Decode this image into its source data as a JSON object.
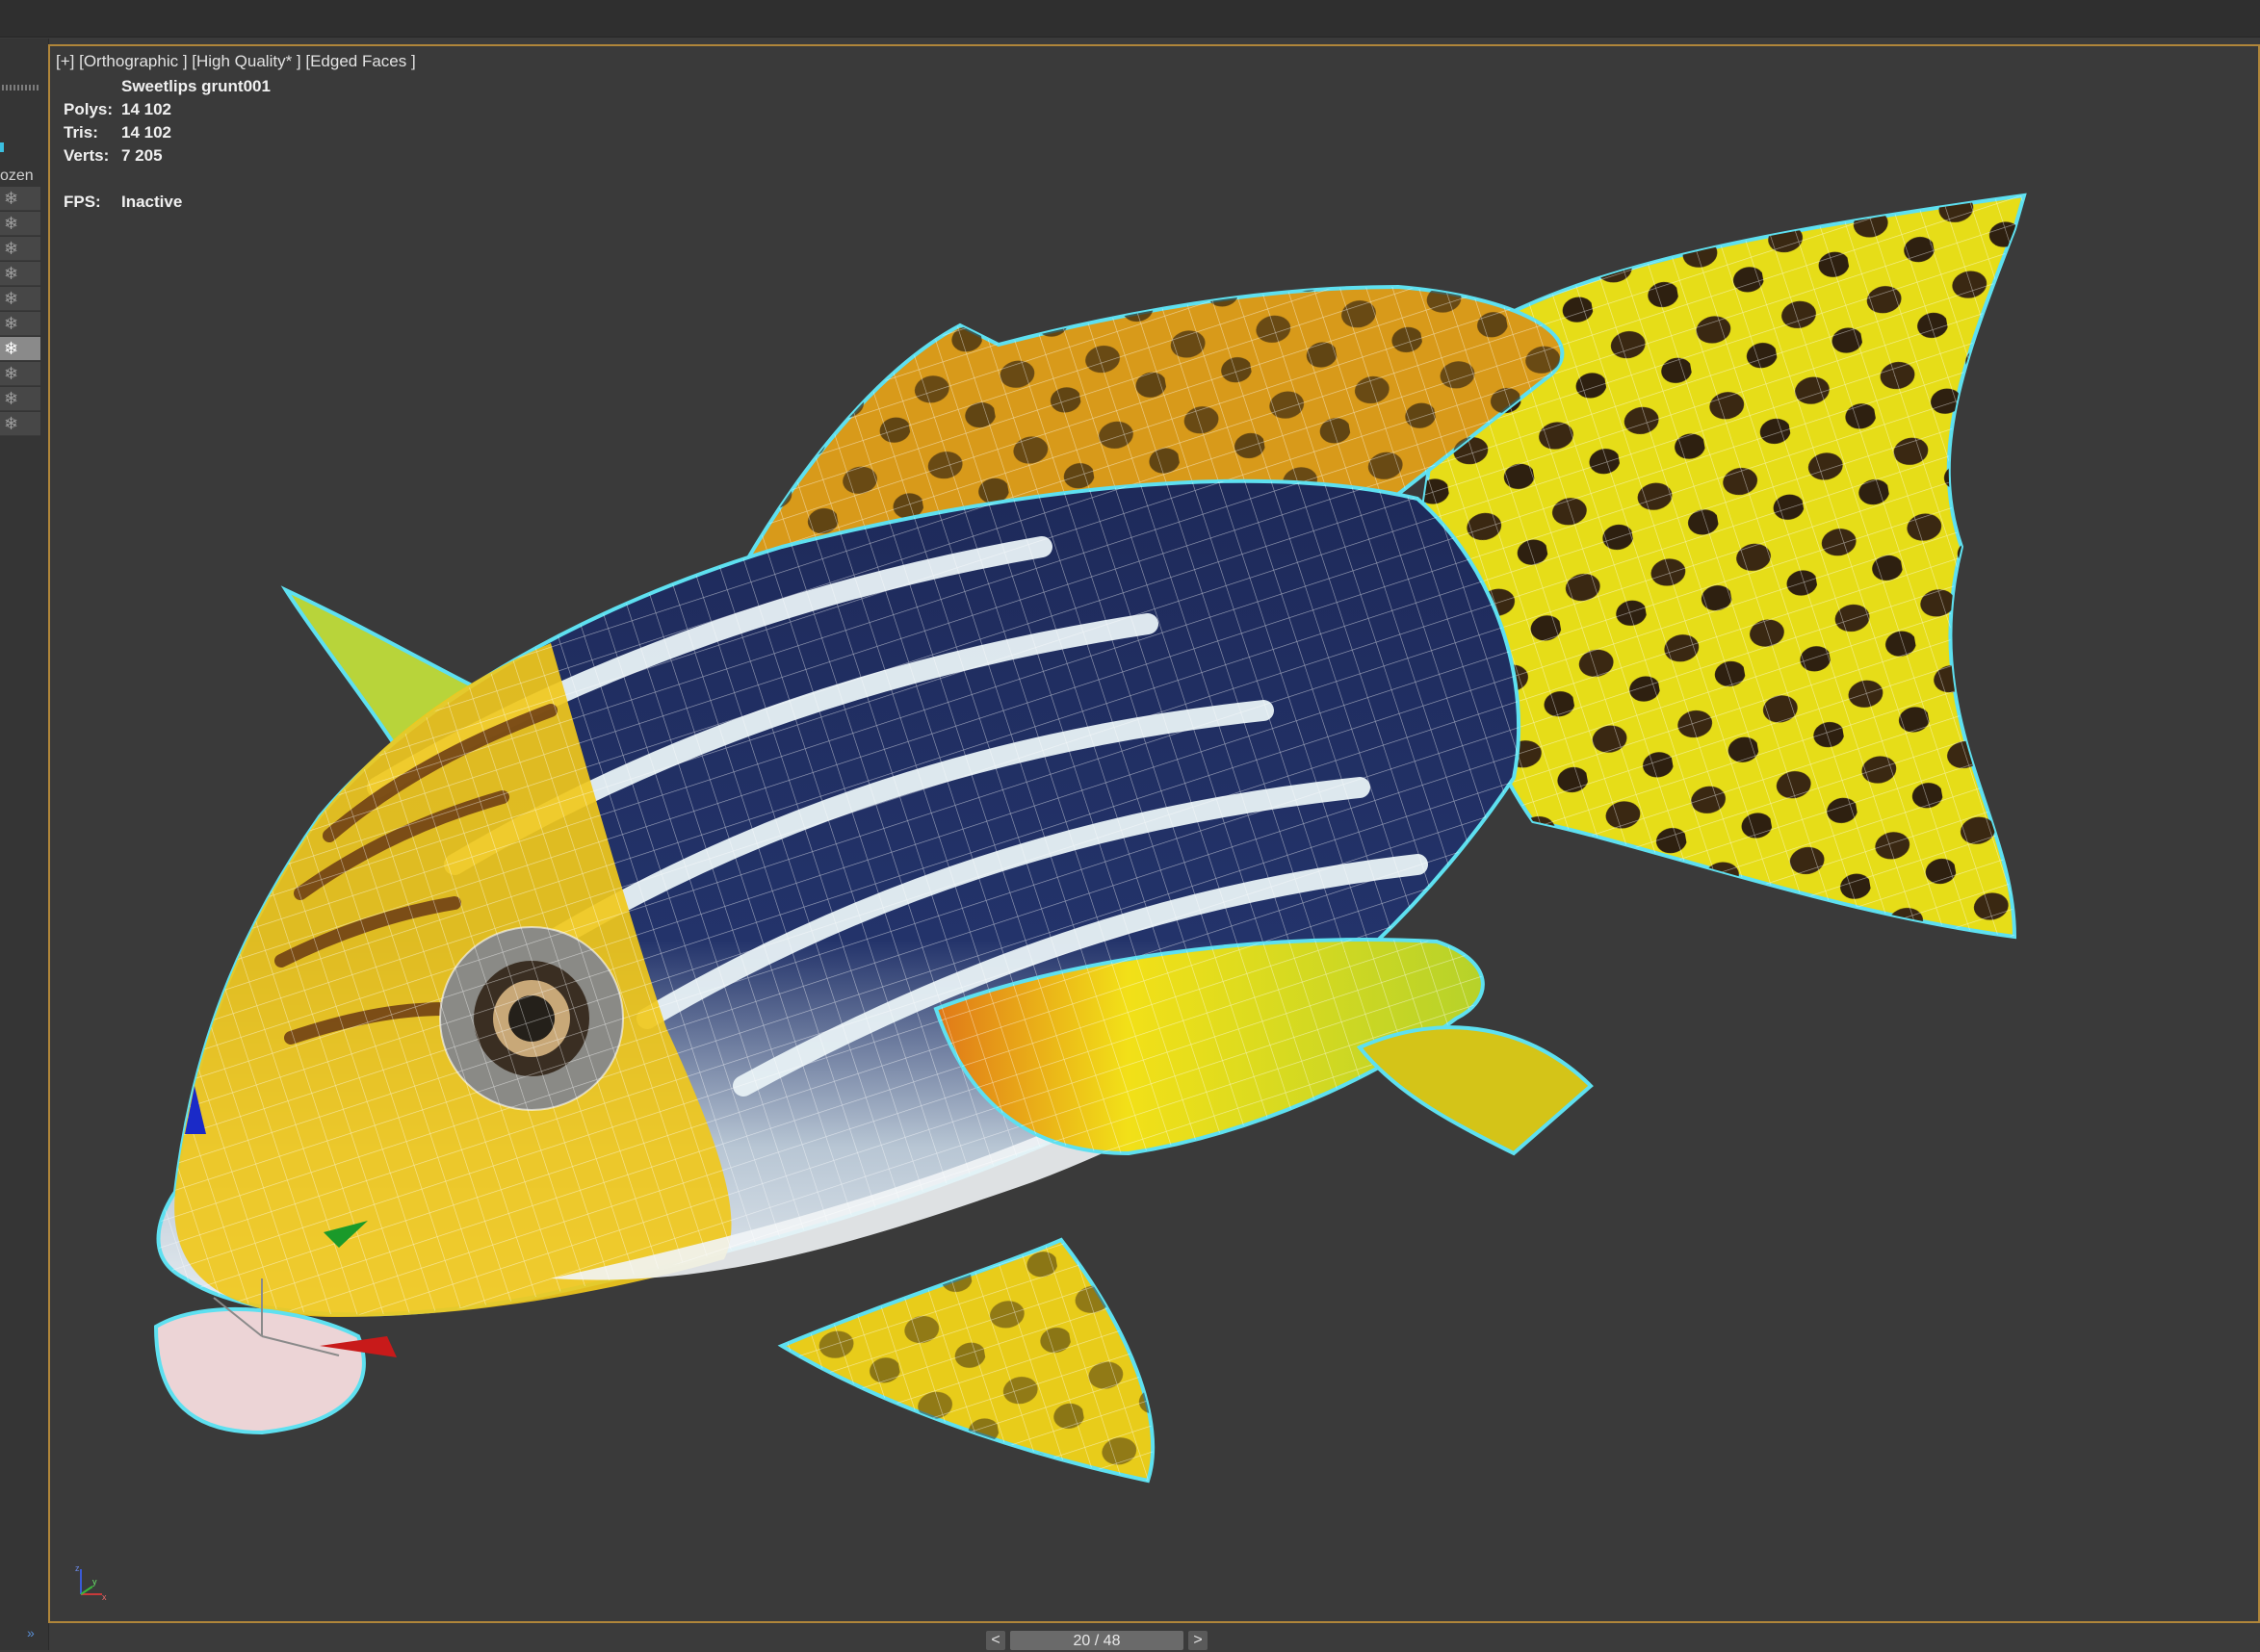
{
  "viewport": {
    "label": "[+] [Orthographic ] [High Quality* ] [Edged Faces ]",
    "object_name": "Sweetlips grunt001",
    "stats": [
      {
        "key": "Polys:",
        "value": "14 102"
      },
      {
        "key": "Tris:",
        "value": "14 102"
      },
      {
        "key": "Verts:",
        "value": "7 205"
      }
    ],
    "fps": {
      "key": "FPS:",
      "value": "Inactive"
    },
    "axis_labels": {
      "z": "z",
      "x": "x",
      "y": "y"
    }
  },
  "left_panel": {
    "frozen_label": "ozen",
    "rows_icon": "snowflake-icon",
    "expand_label": "»"
  },
  "pager": {
    "prev": "<",
    "position": "20 / 48",
    "next": ">"
  },
  "colors": {
    "viewport_border": "#b0863a",
    "selection_outline": "#5ee0f0",
    "background": "#3a3a3a"
  }
}
